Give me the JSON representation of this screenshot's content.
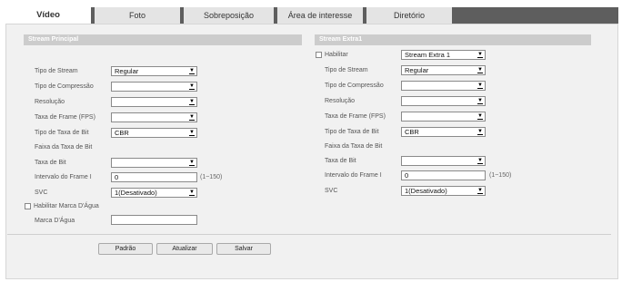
{
  "tabs": [
    "Vídeo",
    "Foto",
    "Sobreposição",
    "Área de interesse",
    "Diretório"
  ],
  "main": {
    "title": "Stream Principal",
    "stream_type": {
      "label": "Tipo de Stream",
      "value": "Regular"
    },
    "compression": {
      "label": "Tipo de Compressão",
      "value": ""
    },
    "resolution": {
      "label": "Resolução",
      "value": ""
    },
    "frame_rate": {
      "label": "Taxa de Frame (FPS)",
      "value": ""
    },
    "bitrate_type": {
      "label": "Tipo de Taxa de Bit",
      "value": "CBR"
    },
    "bitrate_range": {
      "label": "Faixa da Taxa de Bit"
    },
    "bitrate": {
      "label": "Taxa de Bit",
      "value": ""
    },
    "iframe": {
      "label": "Intervalo do Frame I",
      "value": "0",
      "range": "(1~150)"
    },
    "svc": {
      "label": "SVC",
      "value": "1(Desativado)"
    },
    "watermark_enable": {
      "label": "Habilitar Marca D'Água"
    },
    "watermark": {
      "label": "Marca D'Água",
      "value": ""
    }
  },
  "extra": {
    "title": "Stream Extra1",
    "enable": {
      "label": "Habilitar",
      "value": "Stream Extra 1"
    },
    "stream_type": {
      "label": "Tipo de Stream",
      "value": "Regular"
    },
    "compression": {
      "label": "Tipo de Compressão",
      "value": ""
    },
    "resolution": {
      "label": "Resolução",
      "value": ""
    },
    "frame_rate": {
      "label": "Taxa de Frame (FPS)",
      "value": ""
    },
    "bitrate_type": {
      "label": "Tipo de Taxa de Bit",
      "value": "CBR"
    },
    "bitrate_range": {
      "label": "Faixa da Taxa de Bit"
    },
    "bitrate": {
      "label": "Taxa de Bit",
      "value": ""
    },
    "iframe": {
      "label": "Intervalo do Frame I",
      "value": "0",
      "range": "(1~150)"
    },
    "svc": {
      "label": "SVC",
      "value": "1(Desativado)"
    }
  },
  "buttons": {
    "default": "Padrão",
    "refresh": "Atualizar",
    "save": "Salvar"
  },
  "icons": {
    "dropdown": "chevron-down-icon"
  },
  "colors": {
    "tabbar": "#5e5e5e",
    "panel": "#f1f1f1",
    "section_header": "#cccccc"
  }
}
